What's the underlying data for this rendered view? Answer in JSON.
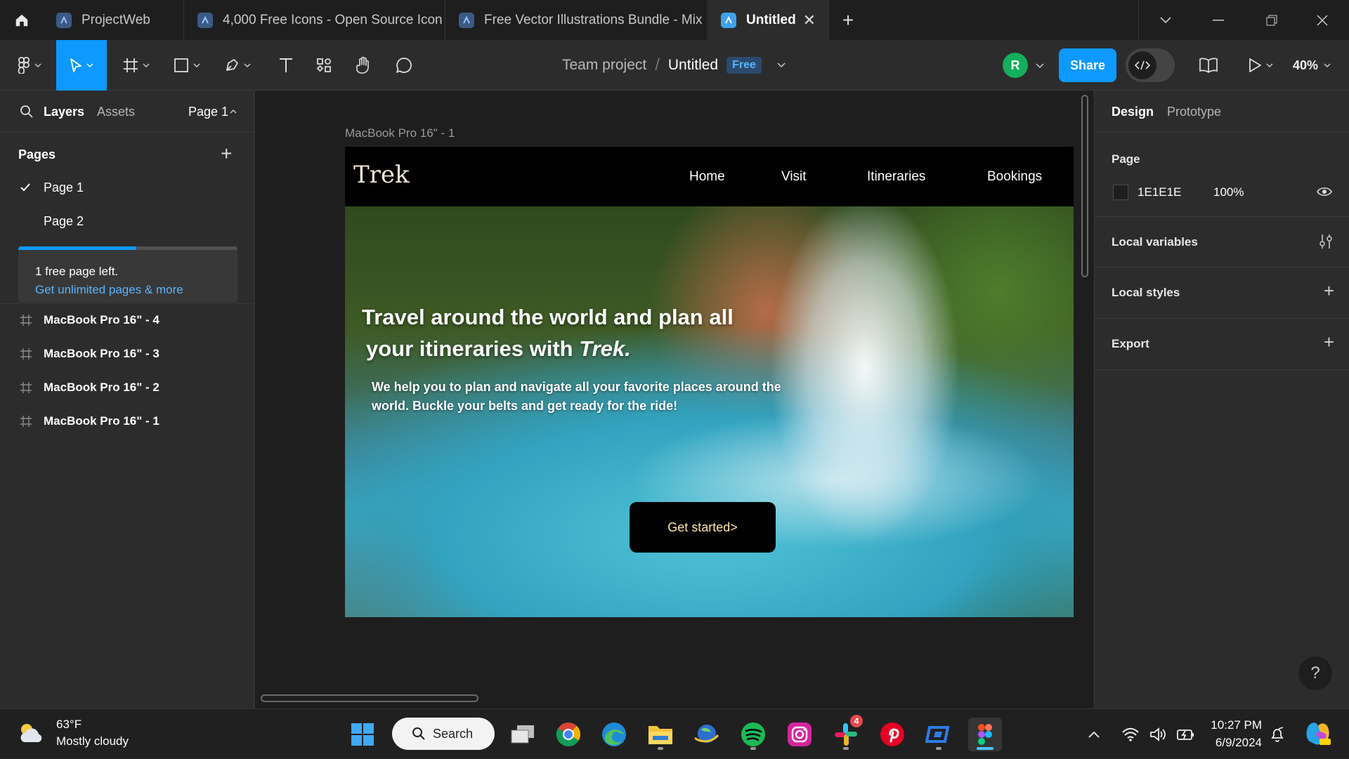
{
  "tabs": [
    {
      "label": "ProjectWeb"
    },
    {
      "label": "4,000 Free Icons - Open Source Icon"
    },
    {
      "label": "Free Vector Illustrations Bundle - Mix"
    },
    {
      "label": "Untitled"
    }
  ],
  "toolbar": {
    "team": "Team project",
    "separator": "/",
    "file_name": "Untitled",
    "plan_badge": "Free",
    "avatar_initial": "R",
    "share_label": "Share",
    "zoom": "40%"
  },
  "left_panel": {
    "tab_layers": "Layers",
    "tab_assets": "Assets",
    "page_selector": "Page 1",
    "pages_title": "Pages",
    "pages": [
      {
        "label": "Page 1",
        "selected": true
      },
      {
        "label": "Page 2",
        "selected": false
      }
    ],
    "upsell_progress": 0.54,
    "upsell_line1": "1 free page left.",
    "upsell_link": "Get unlimited pages & more",
    "layers": [
      {
        "label": "MacBook Pro 16\" - 4"
      },
      {
        "label": "MacBook Pro 16\" - 3"
      },
      {
        "label": "MacBook Pro 16\" - 2"
      },
      {
        "label": "MacBook Pro 16\" - 1"
      }
    ]
  },
  "canvas": {
    "frame_label": "MacBook Pro 16\" - 1",
    "site": {
      "logo": "Trek",
      "nav": [
        "Home",
        "Visit",
        "Itineraries",
        "Bookings"
      ],
      "hero_title_1": "Travel around the world and plan all",
      "hero_title_2": "your itineraries with ",
      "hero_title_brand": "Trek.",
      "hero_sub": "We help you to plan and navigate all your favorite places around the world. Buckle your belts and get ready for the ride!",
      "cta": "Get started>"
    }
  },
  "right_panel": {
    "tab_design": "Design",
    "tab_prototype": "Prototype",
    "page_section": "Page",
    "page_color": "1E1E1E",
    "page_opacity": "100%",
    "local_variables": "Local variables",
    "local_styles": "Local styles",
    "export": "Export",
    "help": "?"
  },
  "taskbar": {
    "temperature": "63°F",
    "weather": "Mostly cloudy",
    "search": "Search",
    "slack_badge": "4",
    "time": "10:27 PM",
    "date": "6/9/2024"
  },
  "colors": {
    "accent": "#0d99ff",
    "panel": "#2c2c2c",
    "canvas": "#1e1e1e",
    "avatar": "#14ae5c"
  }
}
